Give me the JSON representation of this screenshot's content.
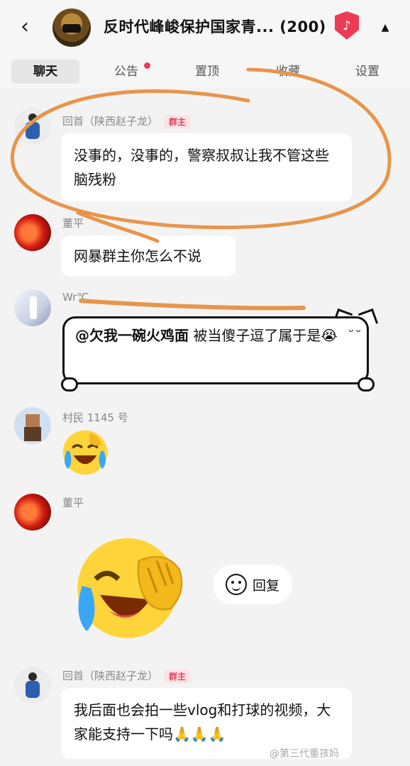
{
  "header": {
    "title": "反时代峰峻保护国家青...",
    "member_count": "(200)",
    "back_glyph": "‹",
    "collapse_glyph": "▲",
    "app_badge_glyph": "♪"
  },
  "tabs": [
    {
      "label": "聊天",
      "active": true
    },
    {
      "label": "公告",
      "has_dot": true
    },
    {
      "label": "置顶"
    },
    {
      "label": "收藏"
    },
    {
      "label": "设置"
    }
  ],
  "messages": [
    {
      "sender": "回首（陕西赵子龙）",
      "tag": "群主",
      "text": "没事的，没事的，警察叔叔让我不管这些脑残粉"
    },
    {
      "sender": "董平",
      "text": "网暴群主你怎么不说"
    },
    {
      "sender": "Wr℃",
      "mention": "@欠我一碗火鸡面",
      "text": " 被当傻子逗了属于是😭"
    },
    {
      "sender": "村民 1145 号",
      "sticker": "crying-laughing-emoji"
    },
    {
      "sender": "董平",
      "sticker": "crying-laughing-emoji-large"
    },
    {
      "sender": "回首（陕西赵子龙）",
      "tag": "群主",
      "text": "我后面也会拍一些vlog和打球的视频，大家能支持一下吗🙏🙏🙏"
    }
  ],
  "reply_button": {
    "label": "回复"
  },
  "watermark": "@第三代重孩妈",
  "colors": {
    "accent": "#ee3b54",
    "owner_tag_bg": "#fde4e7",
    "owner_tag_text": "#e2435b",
    "scribble": "#e8954a",
    "bubble_bg": "#ffffff",
    "page_bg": "#f3f3f3"
  }
}
